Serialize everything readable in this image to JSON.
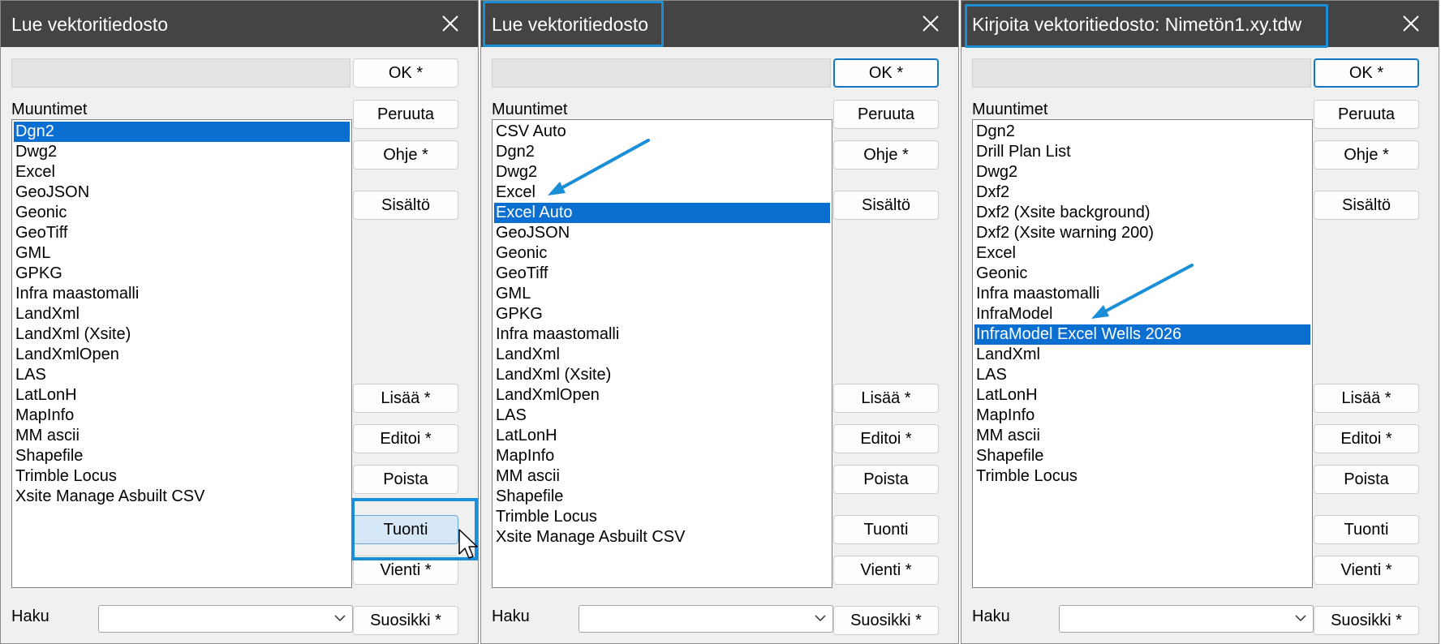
{
  "dialogs": [
    {
      "title": "Lue vektoritiedosto",
      "list_label": "Muuntimet",
      "items": [
        "Dgn2",
        "Dwg2",
        "Excel",
        "GeoJSON",
        "Geonic",
        "GeoTiff",
        "GML",
        "GPKG",
        "Infra maastomalli",
        "LandXml",
        "LandXml (Xsite)",
        "LandXmlOpen",
        "LAS",
        "LatLonH",
        "MapInfo",
        "MM ascii",
        "Shapefile",
        "Trimble Locus",
        "Xsite Manage Asbuilt CSV"
      ],
      "selected_item": "Dgn2",
      "buttons": {
        "ok": "OK *",
        "cancel": "Peruuta",
        "help": "Ohje *",
        "contents": "Sisältö",
        "add": "Lisää *",
        "edit": "Editoi *",
        "delete": "Poista",
        "import": "Tuonti",
        "export": "Vienti *",
        "favorite": "Suosikki *"
      },
      "search_label": "Haku",
      "search_value": ""
    },
    {
      "title": "Lue vektoritiedosto",
      "list_label": "Muuntimet",
      "items": [
        "CSV Auto",
        "Dgn2",
        "Dwg2",
        "Excel",
        "Excel Auto",
        "GeoJSON",
        "Geonic",
        "GeoTiff",
        "GML",
        "GPKG",
        "Infra maastomalli",
        "LandXml",
        "LandXml (Xsite)",
        "LandXmlOpen",
        "LAS",
        "LatLonH",
        "MapInfo",
        "MM ascii",
        "Shapefile",
        "Trimble Locus",
        "Xsite Manage Asbuilt CSV"
      ],
      "selected_item": "Excel Auto",
      "buttons": {
        "ok": "OK *",
        "cancel": "Peruuta",
        "help": "Ohje *",
        "contents": "Sisältö",
        "add": "Lisää *",
        "edit": "Editoi *",
        "delete": "Poista",
        "import": "Tuonti",
        "export": "Vienti *",
        "favorite": "Suosikki *"
      },
      "search_label": "Haku",
      "search_value": ""
    },
    {
      "title": "Kirjoita vektoritiedosto: Nimetön1.xy.tdw",
      "list_label": "Muuntimet",
      "items": [
        "Dgn2",
        "Drill Plan List",
        "Dwg2",
        "Dxf2",
        "Dxf2 (Xsite background)",
        "Dxf2 (Xsite warning 200)",
        "Excel",
        "Geonic",
        "Infra maastomalli",
        "InfraModel",
        "InfraModel Excel Wells 2026",
        "LandXml",
        "LAS",
        "LatLonH",
        "MapInfo",
        "MM ascii",
        "Shapefile",
        "Trimble Locus"
      ],
      "selected_item": "InfraModel Excel Wells 2026",
      "buttons": {
        "ok": "OK *",
        "cancel": "Peruuta",
        "help": "Ohje *",
        "contents": "Sisältö",
        "add": "Lisää *",
        "edit": "Editoi *",
        "delete": "Poista",
        "import": "Tuonti",
        "export": "Vienti *",
        "favorite": "Suosikki *"
      },
      "search_label": "Haku",
      "search_value": ""
    }
  ],
  "colors": {
    "titlebar": "#444444",
    "selection": "#0a6fd0",
    "annotation": "#1a8fd7",
    "default_button_border": "#1576c4"
  },
  "icons": {
    "close": "close-icon",
    "dropdown": "chevron-down-icon",
    "pointer": "mouse-cursor-icon",
    "annotation": "annotation-arrow"
  }
}
